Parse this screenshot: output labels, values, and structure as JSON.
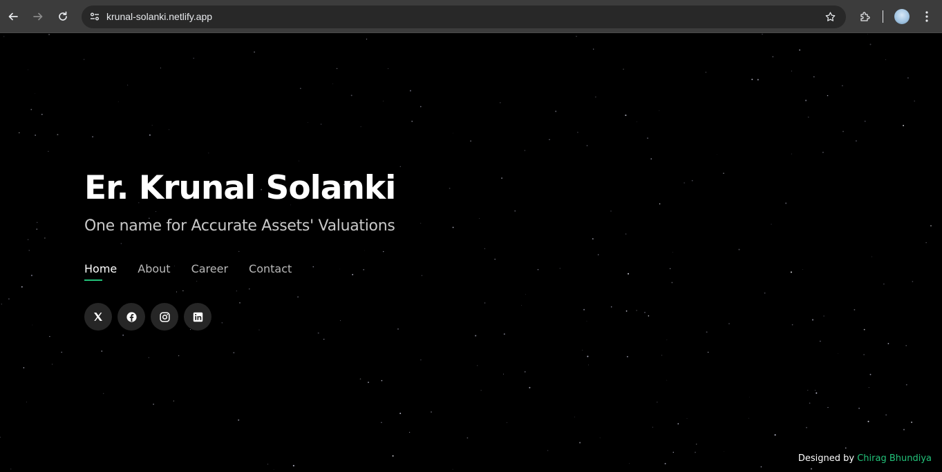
{
  "browser": {
    "url": "krunal-solanki.netlify.app"
  },
  "hero": {
    "name": "Er. Krunal Solanki",
    "tagline": "One name for Accurate Assets' Valuations"
  },
  "nav": {
    "items": [
      {
        "label": "Home"
      },
      {
        "label": "About"
      },
      {
        "label": "Career"
      },
      {
        "label": "Contact"
      }
    ],
    "active": "Home"
  },
  "socials": [
    "x-icon",
    "facebook-icon",
    "instagram-icon",
    "linkedin-icon"
  ],
  "footer": {
    "prefix": "Designed by",
    "author": "Chirag Bhundiya"
  },
  "colors": {
    "accent": "#22c37a",
    "background": "#000000"
  }
}
